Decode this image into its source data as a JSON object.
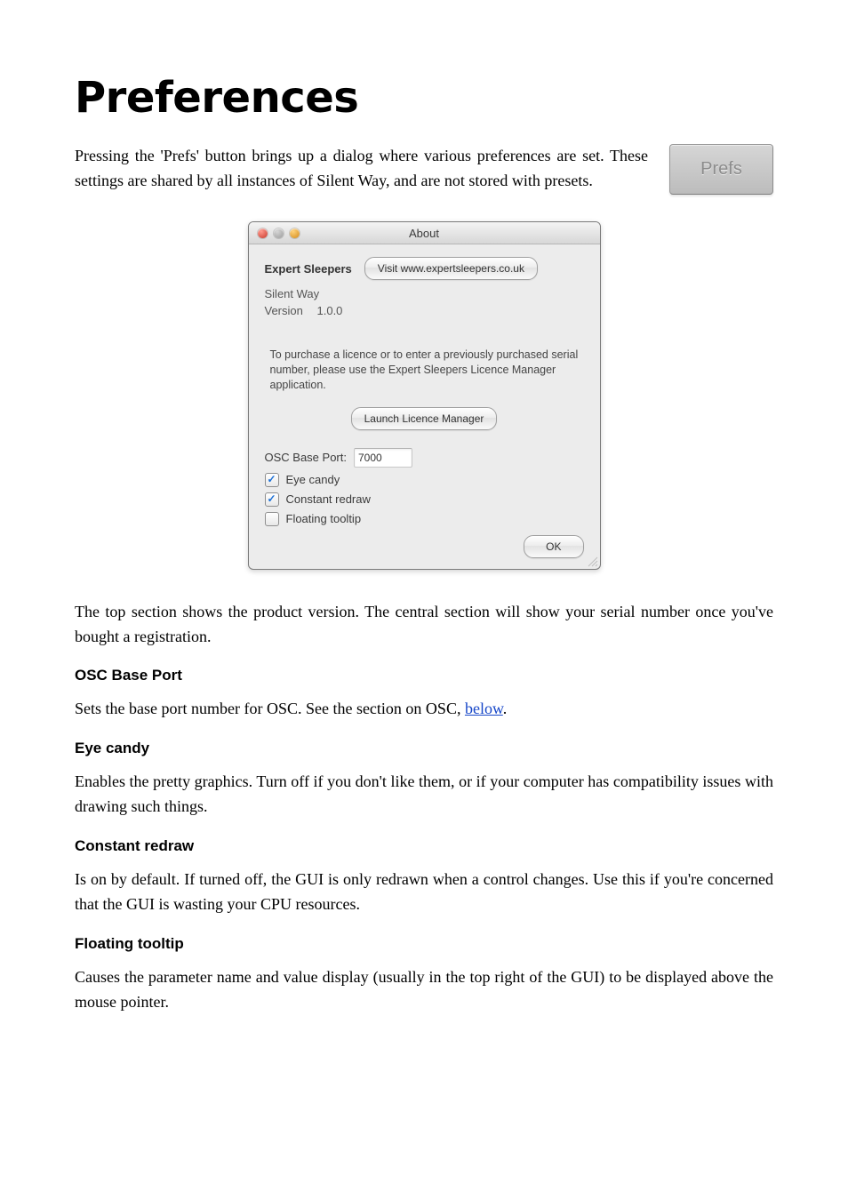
{
  "title": "Preferences",
  "intro": "Pressing the 'Prefs' button brings up a dialog where various preferences are set. These settings are shared by all instances of Silent Way, and are not stored with presets.",
  "prefs_chip_label": "Prefs",
  "dialog": {
    "window_title": "About",
    "brand": "Expert Sleepers",
    "visit_button": "Visit www.expertsleepers.co.uk",
    "product": "Silent Way",
    "version_label": "Version",
    "version_value": "1.0.0",
    "licence_text": "To purchase a licence or to enter a previously purchased serial number, please use the Expert Sleepers Licence Manager application.",
    "launch_button": "Launch Licence Manager",
    "osc_label": "OSC Base Port:",
    "osc_value": "7000",
    "options": {
      "eye_candy": {
        "label": "Eye candy",
        "checked": true
      },
      "constant_redraw": {
        "label": "Constant redraw",
        "checked": true
      },
      "floating_tooltip": {
        "label": "Floating tooltip",
        "checked": false
      }
    },
    "ok_label": "OK"
  },
  "para_after_dialog": "The top section shows the product version. The central section will show your serial number once you've bought a registration.",
  "sections": {
    "osc": {
      "heading": "OSC Base Port",
      "text_before_link": "Sets the base port number for OSC. See the section on OSC, ",
      "link_text": "below",
      "text_after_link": "."
    },
    "eye_candy": {
      "heading": "Eye candy",
      "text": "Enables the pretty graphics. Turn off if you don't like them, or if your computer has compatibility issues with drawing such things."
    },
    "constant_redraw": {
      "heading": "Constant redraw",
      "text": "Is on by default. If turned off, the GUI is only redrawn when a control changes. Use this if you're concerned that the GUI is wasting your CPU resources."
    },
    "floating_tooltip": {
      "heading": "Floating tooltip",
      "text": "Causes the parameter name and value display (usually in the top right of the GUI) to be displayed above the mouse pointer."
    }
  }
}
